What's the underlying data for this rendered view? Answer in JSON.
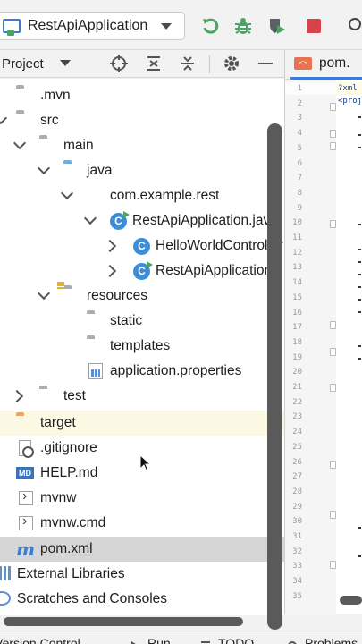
{
  "toolbar": {
    "run_config": "RestApiApplication",
    "icons": [
      "rerun-icon",
      "debug-bug-icon",
      "run-with-coverage-icon",
      "stop-icon"
    ]
  },
  "project_panel": {
    "title": "Project",
    "header_icons": [
      "locate-icon",
      "expand-all-icon",
      "collapse-all-icon",
      "gear-icon",
      "minimize-icon"
    ]
  },
  "tree": [
    {
      "label": ".mvn",
      "type": "folder"
    },
    {
      "label": "src",
      "type": "folder"
    },
    {
      "label": "main",
      "type": "folder"
    },
    {
      "label": "java",
      "type": "source-folder"
    },
    {
      "label": "com.example.rest",
      "type": "package"
    },
    {
      "label": "RestApiApplication.java",
      "type": "class"
    },
    {
      "label": "HelloWorldController",
      "type": "class"
    },
    {
      "label": "RestApiApplication",
      "type": "class"
    },
    {
      "label": "resources",
      "type": "resource-folder"
    },
    {
      "label": "static",
      "type": "folder"
    },
    {
      "label": "templates",
      "type": "folder"
    },
    {
      "label": "application.properties",
      "type": "properties-file"
    },
    {
      "label": "test",
      "type": "folder"
    },
    {
      "label": "target",
      "type": "excluded-folder"
    },
    {
      "label": ".gitignore",
      "type": "gitignore-file"
    },
    {
      "label": "HELP.md",
      "type": "markdown-file"
    },
    {
      "label": "mvnw",
      "type": "script-file"
    },
    {
      "label": "mvnw.cmd",
      "type": "script-file"
    },
    {
      "label": "pom.xml",
      "type": "maven-file"
    },
    {
      "label": "External Libraries",
      "type": "libraries"
    },
    {
      "label": "Scratches and Consoles",
      "type": "scratches"
    }
  ],
  "editor": {
    "tab_label": "pom.",
    "code_fragments": [
      "?xml",
      "<proj"
    ],
    "line_numbers": [
      "1",
      "2",
      "3",
      "4",
      "5",
      "6",
      "7",
      "8",
      "9",
      "10",
      "11",
      "12",
      "13",
      "14",
      "15",
      "16",
      "17",
      "18",
      "19",
      "20",
      "21",
      "22",
      "23",
      "24",
      "25",
      "26",
      "27",
      "28",
      "29",
      "30",
      "31",
      "32",
      "33",
      "34",
      "35"
    ]
  },
  "bottom_bar": {
    "items": [
      "Version Control",
      "Run",
      "TODO",
      "Problems"
    ]
  },
  "colors": {
    "accent": "#3b7bd6",
    "run_green": "#4aa563",
    "stop_red": "#d8424b",
    "highlight_row": "#fbf8e3",
    "selected_row": "#d5d5d5"
  }
}
